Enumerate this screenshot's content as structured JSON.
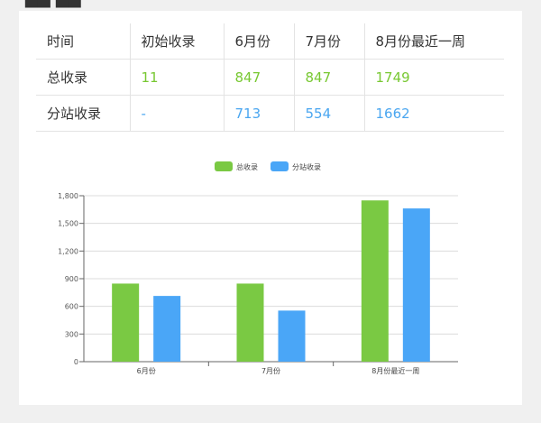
{
  "table": {
    "header": [
      "时间",
      "初始收录",
      "6月份",
      "7月份",
      "8月份最近一周"
    ],
    "rows": [
      {
        "label": "总收录",
        "values": [
          "11",
          "847",
          "847",
          "1749"
        ]
      },
      {
        "label": "分站收录",
        "values": [
          "-",
          "713",
          "554",
          "1662"
        ]
      }
    ]
  },
  "colors": {
    "series_total": "#7ac943",
    "series_sub": "#4aa6f7",
    "table_green": "#78c832",
    "table_blue": "#4aa6f0"
  },
  "chart_data": {
    "type": "bar",
    "categories": [
      "6月份",
      "7月份",
      "8月份最近一周"
    ],
    "series": [
      {
        "name": "总收录",
        "values": [
          847,
          847,
          1749
        ]
      },
      {
        "name": "分站收录",
        "values": [
          713,
          554,
          1662
        ]
      }
    ],
    "yticks": [
      "0",
      "300",
      "600",
      "900",
      "1,200",
      "1,500",
      "1,800"
    ],
    "ylim": [
      0,
      1800
    ],
    "grid": true,
    "legend_position": "top-center"
  }
}
